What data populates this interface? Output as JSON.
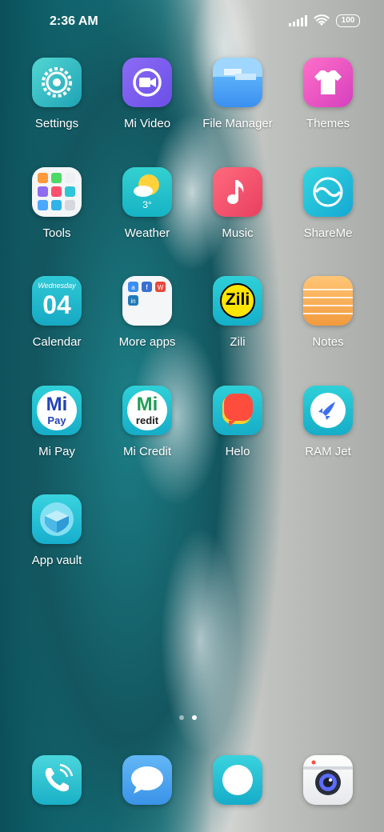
{
  "status": {
    "time": "2:36 AM",
    "battery": "100"
  },
  "apps": [
    {
      "label": "Settings"
    },
    {
      "label": "Mi Video"
    },
    {
      "label": "File Manager"
    },
    {
      "label": "Themes"
    },
    {
      "label": "Tools"
    },
    {
      "label": "Weather",
      "temp": "3°"
    },
    {
      "label": "Music"
    },
    {
      "label": "ShareMe"
    },
    {
      "label": "Calendar",
      "weekday": "Wednesday",
      "day": "04"
    },
    {
      "label": "More apps"
    },
    {
      "label": "Zili",
      "icon_text": "Zili"
    },
    {
      "label": "Notes"
    },
    {
      "label": "Mi Pay",
      "icon_text": "Mi",
      "icon_sub": "Pay"
    },
    {
      "label": "Mi Credit",
      "icon_text": "Mi",
      "icon_sub": "redit"
    },
    {
      "label": "Helo"
    },
    {
      "label": "RAM Jet"
    },
    {
      "label": "App vault"
    }
  ],
  "dock": [
    {
      "name": "phone"
    },
    {
      "name": "messaging"
    },
    {
      "name": "browser"
    },
    {
      "name": "camera"
    }
  ],
  "pages": {
    "count": 2,
    "active": 2
  }
}
